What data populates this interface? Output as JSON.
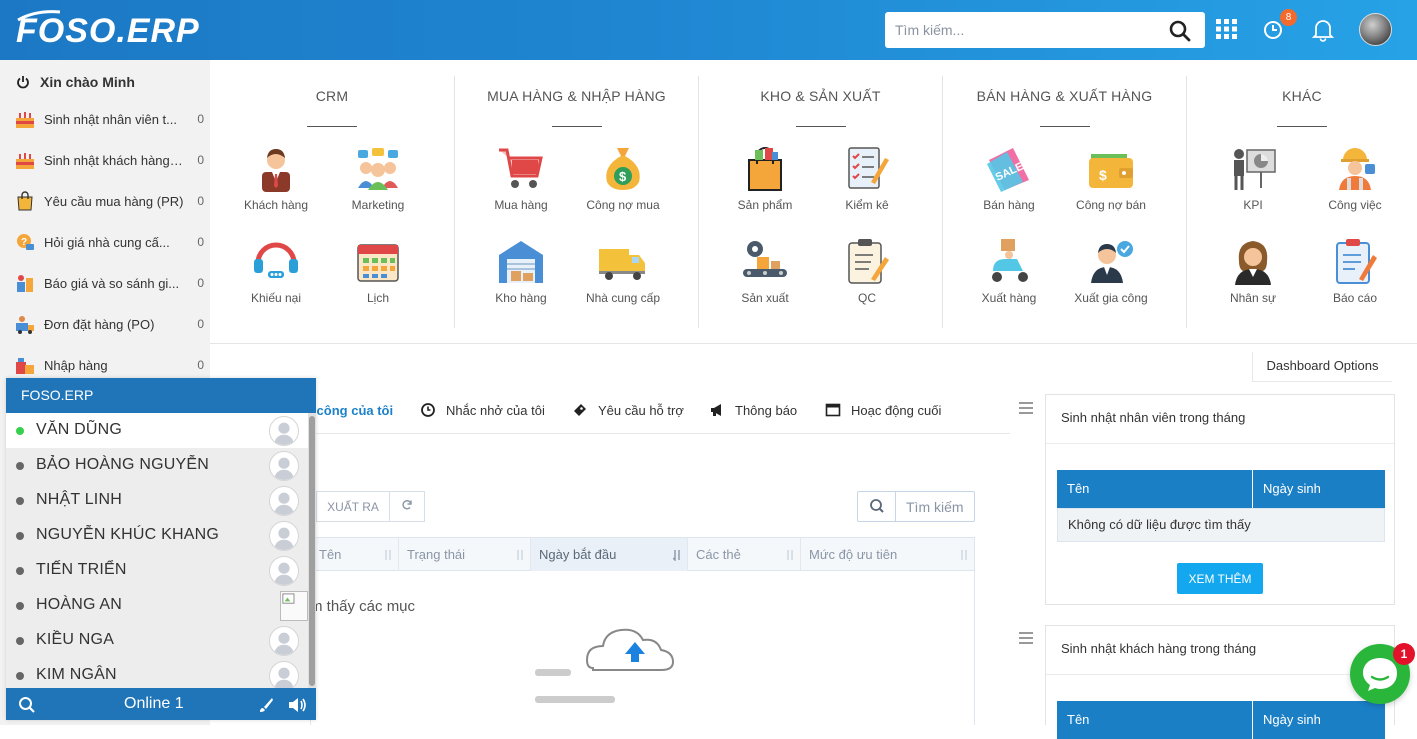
{
  "header": {
    "logo_text": "FOSO.ERP",
    "search_placeholder": "Tìm kiếm...",
    "notification_count": "8",
    "colors": {
      "primary": "#1f86d2",
      "accent": "#f36a2c"
    }
  },
  "sidebar": {
    "greeting": "Xin chào Minh",
    "items": [
      {
        "label": "Sinh nhật nhân viên t...",
        "count": "0",
        "icon": "cake-icon"
      },
      {
        "label": "Sinh nhật khách hàng ...",
        "count": "0",
        "icon": "cake-icon"
      },
      {
        "label": "Yêu cầu mua hàng (PR)",
        "count": "0",
        "icon": "shopping-bag-icon"
      },
      {
        "label": "Hỏi giá nhà cung cấ...",
        "count": "0",
        "icon": "question-chat-icon"
      },
      {
        "label": "Báo giá và so sánh gi...",
        "count": "0",
        "icon": "price-compare-icon"
      },
      {
        "label": "Đơn đặt hàng (PO)",
        "count": "0",
        "icon": "purchase-order-icon"
      },
      {
        "label": "Nhập hàng",
        "count": "0",
        "icon": "import-goods-icon"
      }
    ]
  },
  "modules": [
    {
      "title": "CRM",
      "items": [
        {
          "label": "Khách hàng",
          "icon": "customer-icon"
        },
        {
          "label": "Marketing",
          "icon": "marketing-icon"
        },
        {
          "label": "Khiếu nại",
          "icon": "complaint-headset-icon"
        },
        {
          "label": "Lịch",
          "icon": "calendar-icon"
        }
      ]
    },
    {
      "title": "MUA HÀNG & NHẬP HÀNG",
      "items": [
        {
          "label": "Mua hàng",
          "icon": "shopping-cart-icon"
        },
        {
          "label": "Công nợ mua",
          "icon": "money-bag-icon"
        },
        {
          "label": "Kho hàng",
          "icon": "warehouse-icon"
        },
        {
          "label": "Nhà cung cấp",
          "icon": "truck-icon"
        }
      ]
    },
    {
      "title": "KHO & SẢN XUẤT",
      "items": [
        {
          "label": "Sản phẩm",
          "icon": "product-bag-icon"
        },
        {
          "label": "Kiểm kê",
          "icon": "checklist-icon"
        },
        {
          "label": "Sản xuất",
          "icon": "production-gear-icon"
        },
        {
          "label": "QC",
          "icon": "qc-clipboard-icon"
        }
      ]
    },
    {
      "title": "BÁN HÀNG & XUẤT HÀNG",
      "items": [
        {
          "label": "Bán hàng",
          "icon": "sale-tag-icon"
        },
        {
          "label": "Công nợ bán",
          "icon": "wallet-icon"
        },
        {
          "label": "Xuất hàng",
          "icon": "delivery-scooter-icon"
        },
        {
          "label": "Xuất gia công",
          "icon": "outsource-person-icon"
        }
      ]
    },
    {
      "title": "KHÁC",
      "items": [
        {
          "label": "KPI",
          "icon": "kpi-presentation-icon"
        },
        {
          "label": "Công việc",
          "icon": "worker-icon"
        },
        {
          "label": "Nhân sự",
          "icon": "hr-person-icon"
        },
        {
          "label": "Báo cáo",
          "icon": "report-clipboard-icon"
        }
      ]
    }
  ],
  "dashboard": {
    "options_label": "Dashboard Options",
    "tabs": [
      {
        "label": "n công của tôi",
        "icon": "task-icon",
        "active": true
      },
      {
        "label": "Nhắc nhở của tôi",
        "icon": "clock-icon"
      },
      {
        "label": "Yêu cầu hỗ trợ",
        "icon": "ticket-icon"
      },
      {
        "label": "Thông báo",
        "icon": "megaphone-icon"
      },
      {
        "label": "Hoạc động cuối",
        "icon": "window-icon"
      }
    ],
    "export_label": "XUẤT RA",
    "search_placeholder": "Tìm kiếm",
    "columns": [
      "Tên",
      "Trạng thái",
      "Ngày bắt đầu",
      "Các thẻ",
      "Mức độ ưu tiên"
    ],
    "empty_text": "m thấy các mục"
  },
  "widgets": [
    {
      "title": "Sinh nhật nhân viên trong tháng",
      "col_name": "Tên",
      "col_date": "Ngày sinh",
      "empty": "Không có dữ liệu được tìm thấy",
      "more_label": "XEM THÊM"
    },
    {
      "title": "Sinh nhật khách hàng trong tháng",
      "col_name": "Tên",
      "col_date": "Ngày sinh"
    }
  ],
  "chat": {
    "title": "FOSO.ERP",
    "online_text": "Online 1",
    "users": [
      {
        "name": "VĂN DŨNG",
        "online": true
      },
      {
        "name": "BẢO HOÀNG NGUYỄN",
        "online": false
      },
      {
        "name": "NHẬT LINH",
        "online": false
      },
      {
        "name": "NGUYỄN KHÚC KHANG",
        "online": false
      },
      {
        "name": "TIẾN TRIỂN",
        "online": false
      },
      {
        "name": "HOÀNG AN",
        "online": false
      },
      {
        "name": "KIỀU NGA",
        "online": false
      },
      {
        "name": "KIM NGÂN",
        "online": false
      }
    ]
  },
  "messenger": {
    "badge": "1"
  }
}
